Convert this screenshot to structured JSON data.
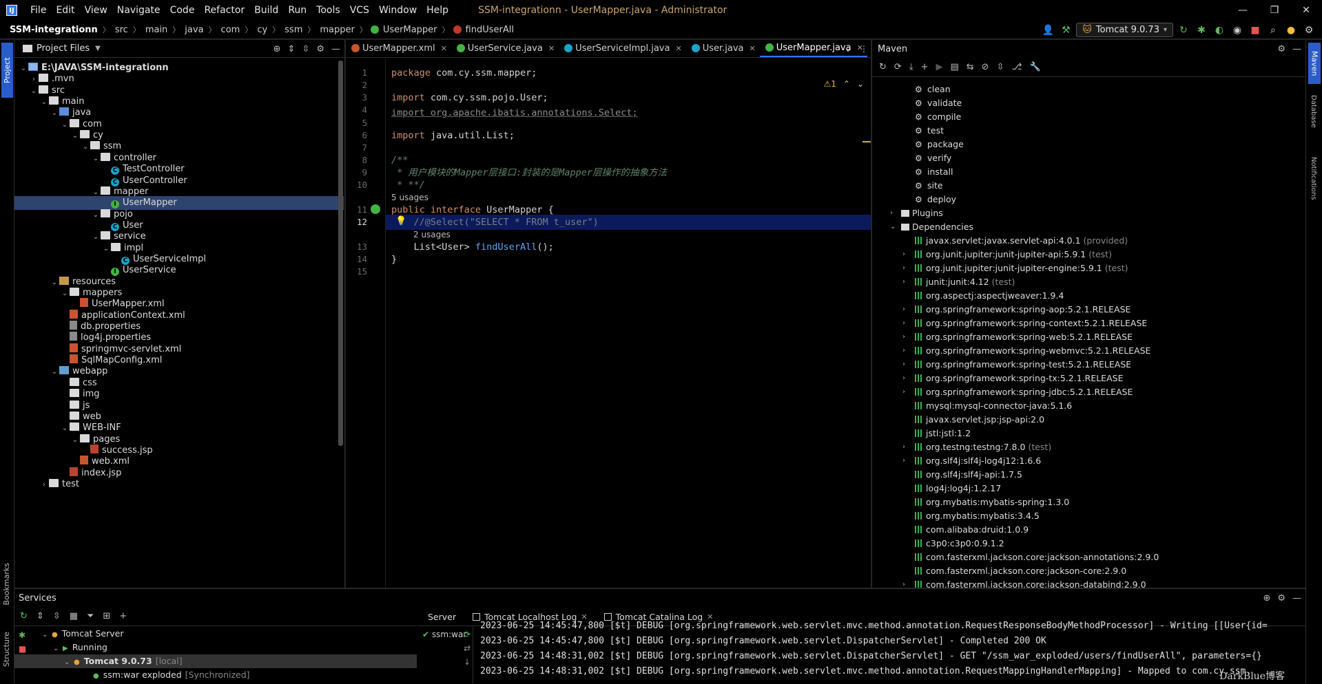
{
  "titlebar": {
    "logo": "IJ",
    "menus": [
      "File",
      "Edit",
      "View",
      "Navigate",
      "Code",
      "Refactor",
      "Build",
      "Run",
      "Tools",
      "VCS",
      "Window",
      "Help"
    ],
    "window_title": "SSM-integrationn - UserMapper.java - Administrator",
    "controls": [
      "—",
      "❐",
      "✕"
    ]
  },
  "navbar": {
    "breadcrumb": [
      "SSM-integrationn",
      "src",
      "main",
      "java",
      "com",
      "cy",
      "ssm",
      "mapper",
      "UserMapper",
      "findUserAll"
    ],
    "run_config": "Tomcat 9.0.73"
  },
  "stripes": {
    "left": {
      "project": "Project",
      "bookmarks": "Bookmarks",
      "structure": "Structure"
    },
    "right": {
      "maven": "Maven",
      "database": "Database",
      "notifications": "Notifications"
    }
  },
  "project": {
    "title": "Project Files",
    "tree": [
      {
        "label": "E:\\JAVA\\SSM-integrationn",
        "depth": 0,
        "arrow": "▾",
        "icon": "module",
        "bold": true
      },
      {
        "label": ".mvn",
        "depth": 1,
        "arrow": "▸",
        "icon": "folder"
      },
      {
        "label": "src",
        "depth": 1,
        "arrow": "▾",
        "icon": "folder"
      },
      {
        "label": "main",
        "depth": 2,
        "arrow": "▾",
        "icon": "folder"
      },
      {
        "label": "java",
        "depth": 3,
        "arrow": "▾",
        "icon": "folder-src"
      },
      {
        "label": "com",
        "depth": 4,
        "arrow": "▾",
        "icon": "folder"
      },
      {
        "label": "cy",
        "depth": 5,
        "arrow": "▾",
        "icon": "folder"
      },
      {
        "label": "ssm",
        "depth": 6,
        "arrow": "▾",
        "icon": "folder"
      },
      {
        "label": "controller",
        "depth": 7,
        "arrow": "▾",
        "icon": "folder"
      },
      {
        "label": "TestController",
        "depth": 8,
        "arrow": "",
        "icon": "class"
      },
      {
        "label": "UserController",
        "depth": 8,
        "arrow": "",
        "icon": "class"
      },
      {
        "label": "mapper",
        "depth": 7,
        "arrow": "▾",
        "icon": "folder"
      },
      {
        "label": "UserMapper",
        "depth": 8,
        "arrow": "",
        "icon": "iface",
        "selected": true
      },
      {
        "label": "pojo",
        "depth": 7,
        "arrow": "▾",
        "icon": "folder"
      },
      {
        "label": "User",
        "depth": 8,
        "arrow": "",
        "icon": "class"
      },
      {
        "label": "service",
        "depth": 7,
        "arrow": "▾",
        "icon": "folder"
      },
      {
        "label": "impl",
        "depth": 8,
        "arrow": "▾",
        "icon": "folder"
      },
      {
        "label": "UserServiceImpl",
        "depth": 9,
        "arrow": "",
        "icon": "class"
      },
      {
        "label": "UserService",
        "depth": 8,
        "arrow": "",
        "icon": "iface"
      },
      {
        "label": "resources",
        "depth": 3,
        "arrow": "▾",
        "icon": "folder-res"
      },
      {
        "label": "mappers",
        "depth": 4,
        "arrow": "▾",
        "icon": "folder"
      },
      {
        "label": "UserMapper.xml",
        "depth": 5,
        "arrow": "",
        "icon": "xml"
      },
      {
        "label": "applicationContext.xml",
        "depth": 4,
        "arrow": "",
        "icon": "xml"
      },
      {
        "label": "db.properties",
        "depth": 4,
        "arrow": "",
        "icon": "props"
      },
      {
        "label": "log4j.properties",
        "depth": 4,
        "arrow": "",
        "icon": "props"
      },
      {
        "label": "springmvc-servlet.xml",
        "depth": 4,
        "arrow": "",
        "icon": "xml"
      },
      {
        "label": "SqlMapConfig.xml",
        "depth": 4,
        "arrow": "",
        "icon": "xml"
      },
      {
        "label": "webapp",
        "depth": 3,
        "arrow": "▾",
        "icon": "folder-web"
      },
      {
        "label": "css",
        "depth": 4,
        "arrow": "",
        "icon": "folder"
      },
      {
        "label": "img",
        "depth": 4,
        "arrow": "",
        "icon": "folder"
      },
      {
        "label": "js",
        "depth": 4,
        "arrow": "",
        "icon": "folder"
      },
      {
        "label": "web",
        "depth": 4,
        "arrow": "",
        "icon": "folder"
      },
      {
        "label": "WEB-INF",
        "depth": 4,
        "arrow": "▾",
        "icon": "folder"
      },
      {
        "label": "pages",
        "depth": 5,
        "arrow": "▾",
        "icon": "folder"
      },
      {
        "label": "success.jsp",
        "depth": 6,
        "arrow": "",
        "icon": "jsp"
      },
      {
        "label": "web.xml",
        "depth": 5,
        "arrow": "",
        "icon": "xml"
      },
      {
        "label": "index.jsp",
        "depth": 4,
        "arrow": "",
        "icon": "jsp"
      },
      {
        "label": "test",
        "depth": 2,
        "arrow": "▸",
        "icon": "folder"
      }
    ]
  },
  "editor": {
    "tabs": [
      {
        "label": "UserMapper.xml",
        "icon_color": "#c7562f",
        "active": false
      },
      {
        "label": "UserService.java",
        "icon_color": "#43b343",
        "active": false
      },
      {
        "label": "UserServiceImpl.java",
        "icon_color": "#1aa3c9",
        "active": false
      },
      {
        "label": "User.java",
        "icon_color": "#1aa3c9",
        "active": false
      },
      {
        "label": "UserMapper.java",
        "icon_color": "#43b343",
        "active": true
      }
    ],
    "inspection": "⚠1",
    "usages_interface": "5 usages",
    "usages_method": "2 usages",
    "line_numbers": [
      "1",
      "2",
      "3",
      "4",
      "5",
      "6",
      "7",
      "8",
      "9",
      "10",
      "11",
      "12",
      "13",
      "14",
      "15"
    ],
    "lines": {
      "l1_kw": "package",
      "l1_rest": " com.cy.ssm.mapper;",
      "l3_kw": "import",
      "l3_rest": " com.cy.ssm.pojo.User;",
      "l4_text": "import org.apache.ibatis.annotations.Select;",
      "l6_kw": "import",
      "l6_rest": " java.util.List;",
      "l8": "/**",
      "l9": " * 用户模块的Mapper层接口:封装的是Mapper层操作的抽象方法",
      "l10": " * **/",
      "l11_kw": "public interface",
      "l11_rest": " UserMapper {",
      "l12_com": "    //@Select(\"SELECT * FROM t_user\")",
      "l13_type": "    List<User> ",
      "l13_fn": "findUserAll",
      "l13_rest": "();",
      "l14": "}"
    }
  },
  "maven": {
    "title": "Maven",
    "lifecycle": [
      "clean",
      "validate",
      "compile",
      "test",
      "package",
      "verify",
      "install",
      "site",
      "deploy"
    ],
    "plugins": "Plugins",
    "dependencies_label": "Dependencies",
    "dependencies": [
      {
        "name": "javax.servlet:javax.servlet-api:4.0.1",
        "scope": "(provided)",
        "expandable": false
      },
      {
        "name": "org.junit.jupiter:junit-jupiter-api:5.9.1",
        "scope": "(test)",
        "expandable": true
      },
      {
        "name": "org.junit.jupiter:junit-jupiter-engine:5.9.1",
        "scope": "(test)",
        "expandable": true
      },
      {
        "name": "junit:junit:4.12",
        "scope": "(test)",
        "expandable": true
      },
      {
        "name": "org.aspectj:aspectjweaver:1.9.4",
        "scope": "",
        "expandable": false
      },
      {
        "name": "org.springframework:spring-aop:5.2.1.RELEASE",
        "scope": "",
        "expandable": true
      },
      {
        "name": "org.springframework:spring-context:5.2.1.RELEASE",
        "scope": "",
        "expandable": true
      },
      {
        "name": "org.springframework:spring-web:5.2.1.RELEASE",
        "scope": "",
        "expandable": true
      },
      {
        "name": "org.springframework:spring-webmvc:5.2.1.RELEASE",
        "scope": "",
        "expandable": true
      },
      {
        "name": "org.springframework:spring-test:5.2.1.RELEASE",
        "scope": "",
        "expandable": true
      },
      {
        "name": "org.springframework:spring-tx:5.2.1.RELEASE",
        "scope": "",
        "expandable": true
      },
      {
        "name": "org.springframework:spring-jdbc:5.2.1.RELEASE",
        "scope": "",
        "expandable": true
      },
      {
        "name": "mysql:mysql-connector-java:5.1.6",
        "scope": "",
        "expandable": false
      },
      {
        "name": "javax.servlet.jsp:jsp-api:2.0",
        "scope": "",
        "expandable": false
      },
      {
        "name": "jstl:jstl:1.2",
        "scope": "",
        "expandable": false
      },
      {
        "name": "org.testng:testng:7.8.0",
        "scope": "(test)",
        "expandable": true
      },
      {
        "name": "org.slf4j:slf4j-log4j12:1.6.6",
        "scope": "",
        "expandable": true
      },
      {
        "name": "org.slf4j:slf4j-api:1.7.5",
        "scope": "",
        "expandable": false
      },
      {
        "name": "log4j:log4j:1.2.17",
        "scope": "",
        "expandable": false
      },
      {
        "name": "org.mybatis:mybatis-spring:1.3.0",
        "scope": "",
        "expandable": false
      },
      {
        "name": "org.mybatis:mybatis:3.4.5",
        "scope": "",
        "expandable": false
      },
      {
        "name": "com.alibaba:druid:1.0.9",
        "scope": "",
        "expandable": false
      },
      {
        "name": "c3p0:c3p0:0.9.1.2",
        "scope": "",
        "expandable": false
      },
      {
        "name": "com.fasterxml.jackson.core:jackson-annotations:2.9.0",
        "scope": "",
        "expandable": false
      },
      {
        "name": "com.fasterxml.jackson.core:jackson-core:2.9.0",
        "scope": "",
        "expandable": false
      },
      {
        "name": "com.fasterxml.jackson.core:jackson-databind:2.9.0",
        "scope": "",
        "expandable": true
      }
    ]
  },
  "services": {
    "title": "Services",
    "tree": [
      {
        "label": "Tomcat Server",
        "extra": ""
      },
      {
        "label": "Running",
        "extra": ""
      },
      {
        "label": "Tomcat 9.0.73",
        "extra": "[local]"
      },
      {
        "label": "ssm:war exploded",
        "extra": "[Synchronized]"
      }
    ],
    "deploy_item": "ssm:war",
    "log_tabs": [
      "Server",
      "Tomcat Localhost Log",
      "Tomcat Catalina Log"
    ],
    "log_lines": [
      "2023-06-25 14:45:47,800 [$t] DEBUG [org.springframework.web.servlet.mvc.method.annotation.RequestResponseBodyMethodProcessor] - Writing [[User{id=",
      "2023-06-25 14:45:47,800 [$t] DEBUG [org.springframework.web.servlet.DispatcherServlet] - Completed 200 OK",
      "2023-06-25 14:48:31,002 [$t] DEBUG [org.springframework.web.servlet.DispatcherServlet] - GET \"/ssm_war_exploded/users/findUserAll\", parameters={}",
      "2023-06-25 14:48:31,002 [$t] DEBUG [org.springframework.web.servlet.mvc.method.annotation.RequestMappingHandlerMapping] - Mapped to com.cy.ssm."
    ],
    "watermark": "DarkBlue博客"
  }
}
